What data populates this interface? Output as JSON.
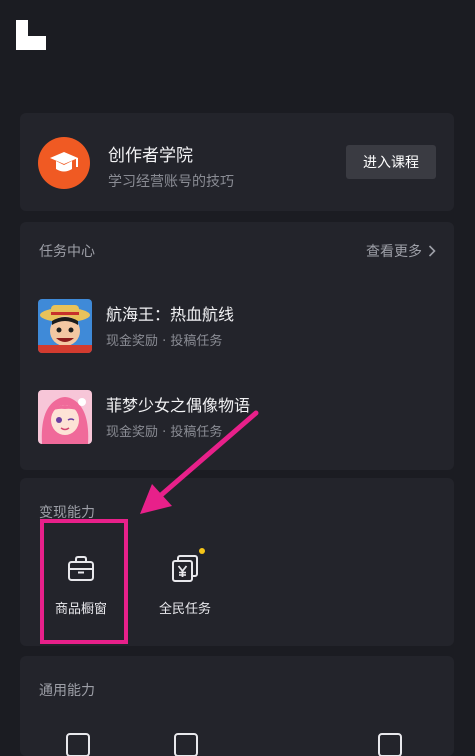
{
  "academy": {
    "title": "创作者学院",
    "subtitle": "学习经营账号的技巧",
    "button_label": "进入课程"
  },
  "tasks": {
    "section_title": "任务中心",
    "more_label": "查看更多",
    "items": [
      {
        "name": "航海王：热血航线",
        "meta": "现金奖励 · 投稿任务"
      },
      {
        "name": "菲梦少女之偶像物语",
        "meta": "现金奖励 · 投稿任务"
      }
    ]
  },
  "monetization": {
    "section_title": "变现能力",
    "items": [
      {
        "label": "商品橱窗",
        "icon": "shop-window-icon"
      },
      {
        "label": "全民任务",
        "icon": "yen-task-icon",
        "badge": true
      }
    ]
  },
  "general": {
    "section_title": "通用能力"
  },
  "annotation_colors": {
    "highlight": "#e8208a"
  },
  "colors": {
    "background": "#1b1c22",
    "card": "#23242b",
    "accent": "#f05a23"
  }
}
